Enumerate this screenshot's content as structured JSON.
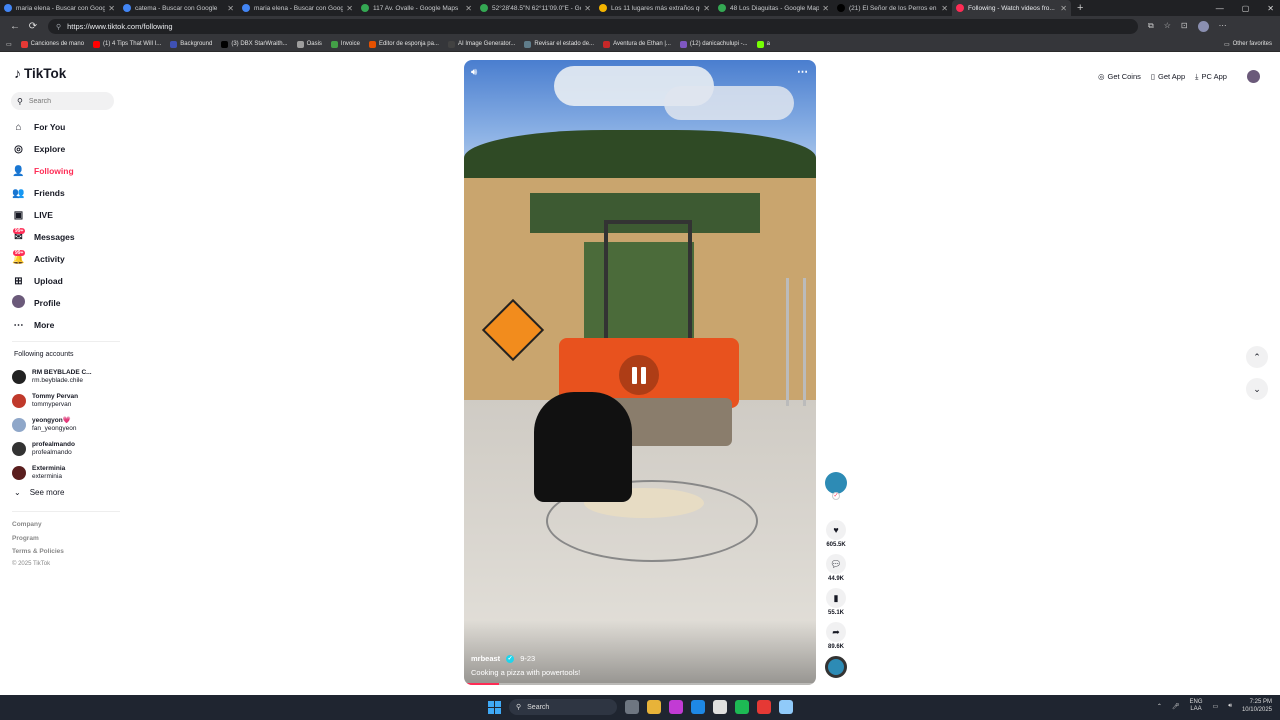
{
  "browser": {
    "tabs": [
      {
        "title": "maria elena - Buscar con Google",
        "color": "#4285f4"
      },
      {
        "title": "catema - Buscar con Google",
        "color": "#4285f4"
      },
      {
        "title": "maria elena - Buscar con Google",
        "color": "#4285f4"
      },
      {
        "title": "117 Av. Ovalle - Google Maps",
        "color": "#34a853"
      },
      {
        "title": "52°28'48.5\"N 62°11'09.0\"E - Goo...",
        "color": "#34a853"
      },
      {
        "title": "Los 11 lugares más extraños que...",
        "color": "#f4b400"
      },
      {
        "title": "48 Los Diaguitas - Google Maps",
        "color": "#34a853"
      },
      {
        "title": "(21) El Señor de los Perros en X",
        "color": "#000000"
      },
      {
        "title": "Following - Watch videos fro...",
        "color": "#fe2c55"
      }
    ],
    "new_tab": "+",
    "url": "https://www.tiktok.com/following",
    "bookmarks": [
      {
        "label": "Canciones de mano",
        "color": "#e53935"
      },
      {
        "label": "(1) 4 Tips That Will I...",
        "color": "#ff0000"
      },
      {
        "label": "Background",
        "color": "#3f51b5"
      },
      {
        "label": "(3) DBX StarWraith...",
        "color": "#000000"
      },
      {
        "label": "Oasis",
        "color": "#9e9e9e"
      },
      {
        "label": "Invoice",
        "color": "#43a047"
      },
      {
        "label": "Editor de esponja pa...",
        "color": "#e65100"
      },
      {
        "label": "AI Image Generator...",
        "color": "#424242"
      },
      {
        "label": "Revisar el estado de...",
        "color": "#607d8b"
      },
      {
        "label": "Aventura de Ethan |...",
        "color": "#c62828"
      },
      {
        "label": "(12) danicachulupi -...",
        "color": "#7e57c2"
      },
      {
        "label": "a",
        "color": "#76ff03"
      }
    ],
    "other_favorites": "Other favorites"
  },
  "sidebar": {
    "logo": "TikTok",
    "search_placeholder": "Search",
    "nav": [
      {
        "label": "For You",
        "icon": "home-icon",
        "glyph": "⌂"
      },
      {
        "label": "Explore",
        "icon": "compass-icon",
        "glyph": "◎"
      },
      {
        "label": "Following",
        "icon": "following-icon",
        "glyph": "👤"
      },
      {
        "label": "Friends",
        "icon": "friends-icon",
        "glyph": "👥"
      },
      {
        "label": "LIVE",
        "icon": "live-icon",
        "glyph": "▣"
      },
      {
        "label": "Messages",
        "icon": "messages-icon",
        "glyph": "✉",
        "badge": "99+"
      },
      {
        "label": "Activity",
        "icon": "activity-icon",
        "glyph": "🔔",
        "badge": "99+"
      },
      {
        "label": "Upload",
        "icon": "upload-icon",
        "glyph": "⊞"
      },
      {
        "label": "Profile",
        "icon": "avatar",
        "glyph": ""
      },
      {
        "label": "More",
        "icon": "more-icon",
        "glyph": "⋯"
      }
    ],
    "following_title": "Following accounts",
    "following": [
      {
        "name": "RM BEYBLADE C...",
        "user": "rm.beyblade.chile",
        "color": "#222222"
      },
      {
        "name": "Tommy Pervan",
        "user": "tommypervan",
        "color": "#c0392b"
      },
      {
        "name": "yeongyon💗",
        "user": "fan_yeongyeon",
        "color": "#8fa7c9"
      },
      {
        "name": "profealmando",
        "user": "profealmando",
        "color": "#333333"
      },
      {
        "name": "Exterminia",
        "user": "exterminia",
        "color": "#5a1e1e"
      }
    ],
    "see_more": "See more",
    "footer": {
      "company": "Company",
      "program": "Program",
      "terms": "Terms & Policies",
      "copyright": "© 2025 TikTok"
    }
  },
  "video": {
    "author": "mrbeast",
    "date": "9-23",
    "caption": "Cooking a pizza with powertools!",
    "progress": 0.1
  },
  "actions": {
    "likes": "605.5K",
    "comments": "44.9K",
    "saves": "55.1K",
    "shares": "89.6K"
  },
  "topbar": {
    "get_coins": "Get Coins",
    "get_app": "Get App",
    "pc_app": "PC App"
  },
  "taskbar": {
    "search": "Search",
    "lang_top": "ENG",
    "lang_bottom": "LAA",
    "time": "7:25 PM",
    "date": "10/10/2025",
    "apps": [
      "#6e7681",
      "#e8b339",
      "#c23bd4",
      "#1e88e5",
      "#e0e0e0",
      "#1db954",
      "#e53935",
      "#90caf9"
    ]
  }
}
